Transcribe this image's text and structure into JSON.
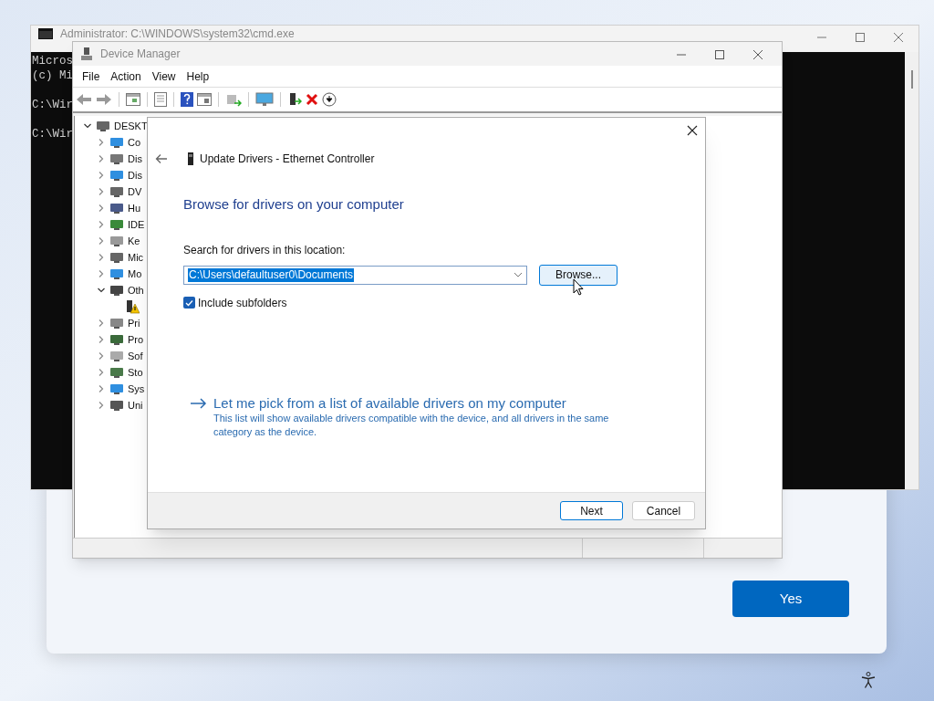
{
  "setup_dialog": {
    "primary_button": "Yes"
  },
  "cmd_window": {
    "title": "Administrator: C:\\WINDOWS\\system32\\cmd.exe",
    "blocks": [
      [
        "Micros",
        "(c) Mi"
      ],
      [
        "C:\\Wir"
      ],
      [
        "C:\\Wir"
      ]
    ]
  },
  "device_manager": {
    "title": "Device Manager",
    "menu": [
      "File",
      "Action",
      "View",
      "Help"
    ],
    "tree": {
      "label": "DESKT",
      "expanded": true,
      "children": [
        {
          "label": "Co",
          "expanded": false
        },
        {
          "label": "Dis",
          "expanded": false
        },
        {
          "label": "Dis",
          "expanded": false
        },
        {
          "label": "DV",
          "expanded": false
        },
        {
          "label": "Hu",
          "expanded": false
        },
        {
          "label": "IDE",
          "expanded": false
        },
        {
          "label": "Ke",
          "expanded": false
        },
        {
          "label": "Mic",
          "expanded": false
        },
        {
          "label": "Mo",
          "expanded": false
        },
        {
          "label": "Oth",
          "expanded": true,
          "children": [
            {
              "kind": "warning-device"
            }
          ]
        },
        {
          "label": "Pri",
          "expanded": false
        },
        {
          "label": "Pro",
          "expanded": false
        },
        {
          "label": "Sof",
          "expanded": false
        },
        {
          "label": "Sto",
          "expanded": false
        },
        {
          "label": "Sys",
          "expanded": false
        },
        {
          "label": "Uni",
          "expanded": false
        }
      ]
    }
  },
  "update_drivers": {
    "title": "Update Drivers - Ethernet Controller",
    "heading": "Browse for drivers on your computer",
    "location_label": "Search for drivers in this location:",
    "location_value": "C:\\Users\\defaultuser0\\Documents",
    "browse_button": "Browse...",
    "include_subfolders": {
      "label": "Include subfolders",
      "checked": true
    },
    "pick_link": {
      "title": "Let me pick from a list of available drivers on my computer",
      "description": "This list will show available drivers compatible with the device, and all drivers in the same category as the device."
    },
    "buttons": [
      {
        "label": "Next",
        "default": true
      },
      {
        "label": "Cancel",
        "default": false
      }
    ]
  }
}
